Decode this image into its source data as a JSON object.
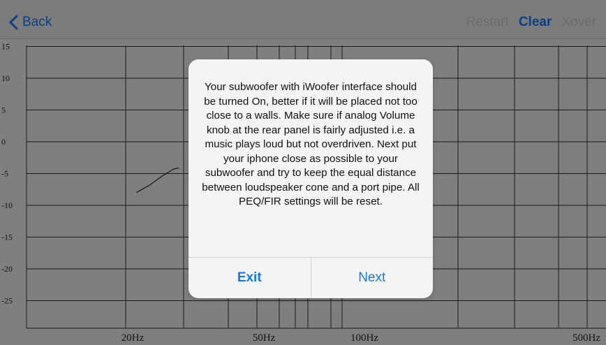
{
  "navbar": {
    "back_label": "Back",
    "restart_label": "Restart",
    "clear_label": "Clear",
    "xover_label": "Xover"
  },
  "chart_data": {
    "type": "line",
    "y_ticks": [
      "15",
      "10",
      "5",
      "0",
      "-5",
      "-10",
      "-15",
      "-20",
      "-25"
    ],
    "x_tick_labels": [
      "20Hz",
      "50Hz",
      "100Hz",
      "500Hz"
    ],
    "grid": true,
    "series": [
      {
        "x": [
          20,
          22,
          24,
          26,
          27
        ],
        "y": [
          -8,
          -6.8,
          -5.4,
          -4.3,
          -4.1
        ]
      }
    ]
  },
  "dialog": {
    "message": "Your subwoofer with iWoofer interface should be turned On, better if it will be placed not too close to a walls. Make sure if analog Volume knob at the rear panel is fairly adjusted i.e. a music plays loud but not overdriven. Next put your iphone close as possible to your subwoofer and try to keep the equal distance between loudspeaker cone and a port pipe. All PEQ/FIR settings will be reset.",
    "exit_label": "Exit",
    "next_label": "Next"
  },
  "colors": {
    "accent": "#1678e0",
    "nav_accent_dimmed": "#0a3f86"
  }
}
